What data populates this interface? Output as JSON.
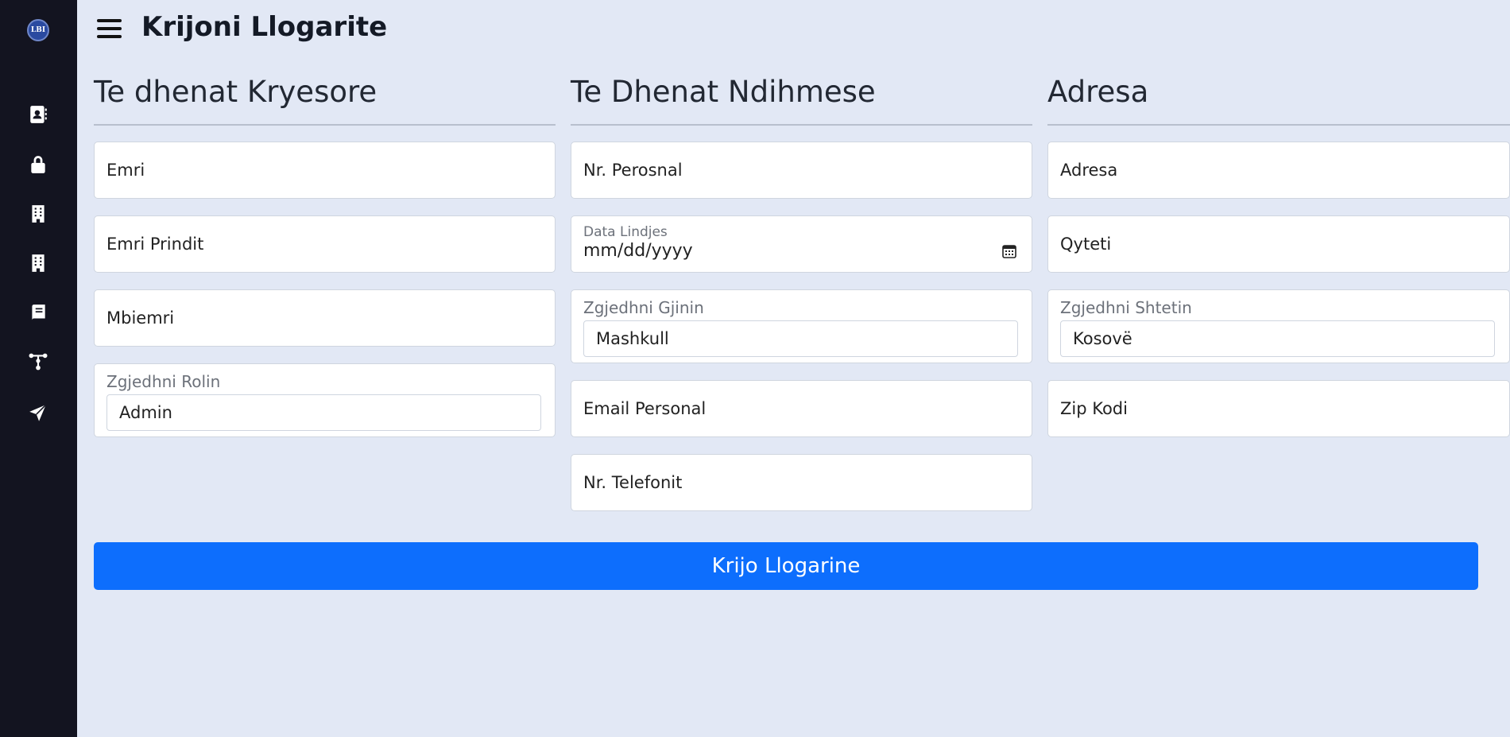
{
  "header": {
    "title": "Krijoni Llogarite"
  },
  "sidebar": {
    "logo_text": "LBI",
    "icons": [
      "contacts-icon",
      "lock-icon",
      "building-icon",
      "building-icon",
      "book-icon",
      "network-icon",
      "send-icon"
    ]
  },
  "sections": {
    "main": {
      "title": "Te dhenat Kryesore",
      "first_name_placeholder": "Emri",
      "parent_name_placeholder": "Emri Prindit",
      "last_name_placeholder": "Mbiemri",
      "role_label": "Zgjedhni Rolin",
      "role_value": "Admin"
    },
    "secondary": {
      "title": "Te Dhenat Ndihmese",
      "personal_no_placeholder": "Nr. Perosnal",
      "birthdate_label": "Data Lindjes",
      "birthdate_value": "mm/dd/yyyy",
      "gender_label": "Zgjedhni Gjinin",
      "gender_value": "Mashkull",
      "email_placeholder": "Email Personal",
      "phone_placeholder": "Nr. Telefonit"
    },
    "address": {
      "title": "Adresa",
      "address_placeholder": "Adresa",
      "city_placeholder": "Qyteti",
      "country_label": "Zgjedhni Shtetin",
      "country_value": "Kosovë",
      "zip_placeholder": "Zip Kodi"
    }
  },
  "actions": {
    "submit_label": "Krijo Llogarine"
  },
  "colors": {
    "sidebar": "#131420",
    "background": "#e2e8f5",
    "primary": "#0d6efd"
  }
}
